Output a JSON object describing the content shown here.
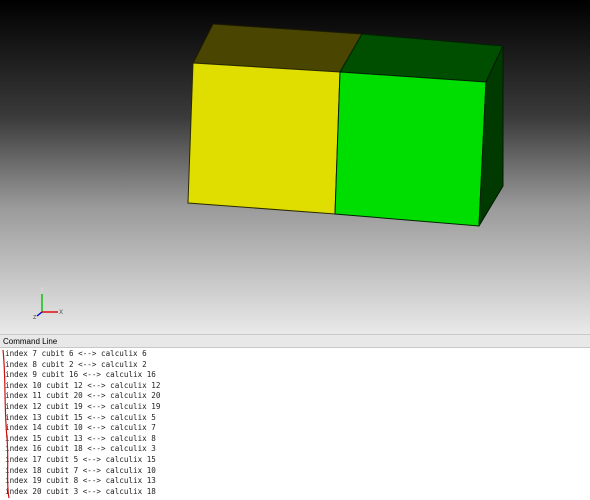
{
  "viewport": {
    "left_block_color": "#e0dd00",
    "left_block_top_color": "#4a4500",
    "right_block_color": "#00dd00",
    "right_block_top_color": "#004f00",
    "right_block_side_color": "#003a00",
    "axis_y_label": "Y",
    "axis_z_label": "Z",
    "axis_x_label": "X"
  },
  "command_panel": {
    "title": "Command Line",
    "lines": [
      "index 7 cubit 6 <--> calculix 6",
      "index 8 cubit 2 <--> calculix 2",
      "index 9 cubit 16 <--> calculix 16",
      "index 10 cubit 12 <--> calculix 12",
      "index 11 cubit 20 <--> calculix 20",
      "index 12 cubit 19 <--> calculix 19",
      "index 13 cubit 15 <--> calculix 5",
      "index 14 cubit 10 <--> calculix 7",
      "index 15 cubit 13 <--> calculix 8",
      "index 16 cubit 18 <--> calculix 3",
      "index 17 cubit 5 <--> calculix 15",
      "index 18 cubit 7 <--> calculix 10",
      "index 19 cubit 8 <--> calculix 13",
      "index 20 cubit 3 <--> calculix 18"
    ]
  }
}
